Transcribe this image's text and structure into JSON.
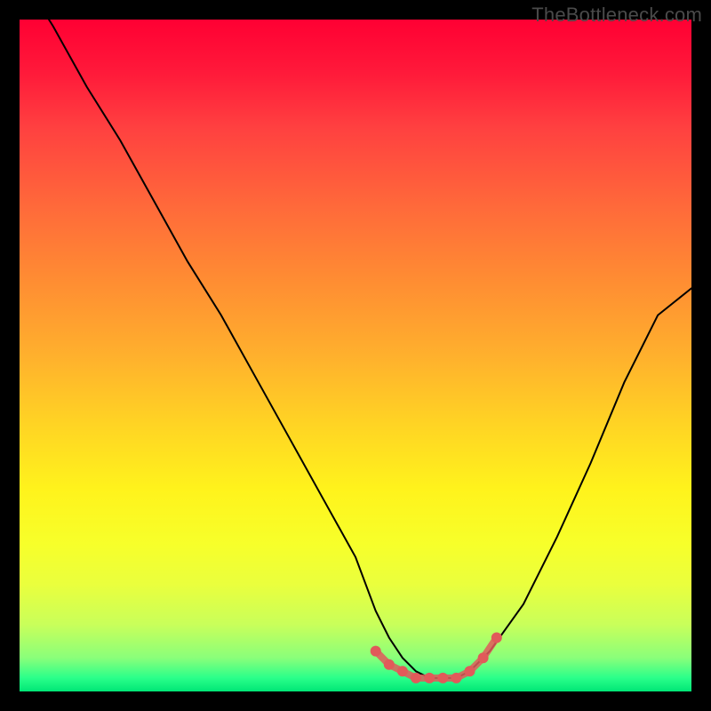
{
  "watermark": "TheBottleneck.com",
  "colors": {
    "background": "#000000",
    "curve": "#000000",
    "markers": "#e05a5a",
    "watermark": "#4a4a4a"
  },
  "chart_data": {
    "type": "line",
    "title": "",
    "xlabel": "",
    "ylabel": "",
    "xlim": [
      0,
      100
    ],
    "ylim": [
      0,
      100
    ],
    "grid": false,
    "legend": false,
    "series": [
      {
        "name": "curve",
        "x": [
          0,
          5,
          10,
          15,
          20,
          25,
          30,
          35,
          40,
          45,
          50,
          53,
          55,
          57,
          59,
          61,
          63,
          65,
          67,
          70,
          75,
          80,
          85,
          90,
          95,
          100
        ],
        "y": [
          107,
          99,
          90,
          82,
          73,
          64,
          56,
          47,
          38,
          29,
          20,
          12,
          8,
          5,
          3,
          2,
          2,
          2,
          3,
          6,
          13,
          23,
          34,
          46,
          56,
          60
        ]
      }
    ],
    "markers": {
      "name": "bottom-dots",
      "x": [
        53,
        55,
        57,
        59,
        61,
        63,
        65,
        67,
        69,
        71
      ],
      "y": [
        6,
        4,
        3,
        2,
        2,
        2,
        2,
        3,
        5,
        8
      ]
    }
  }
}
